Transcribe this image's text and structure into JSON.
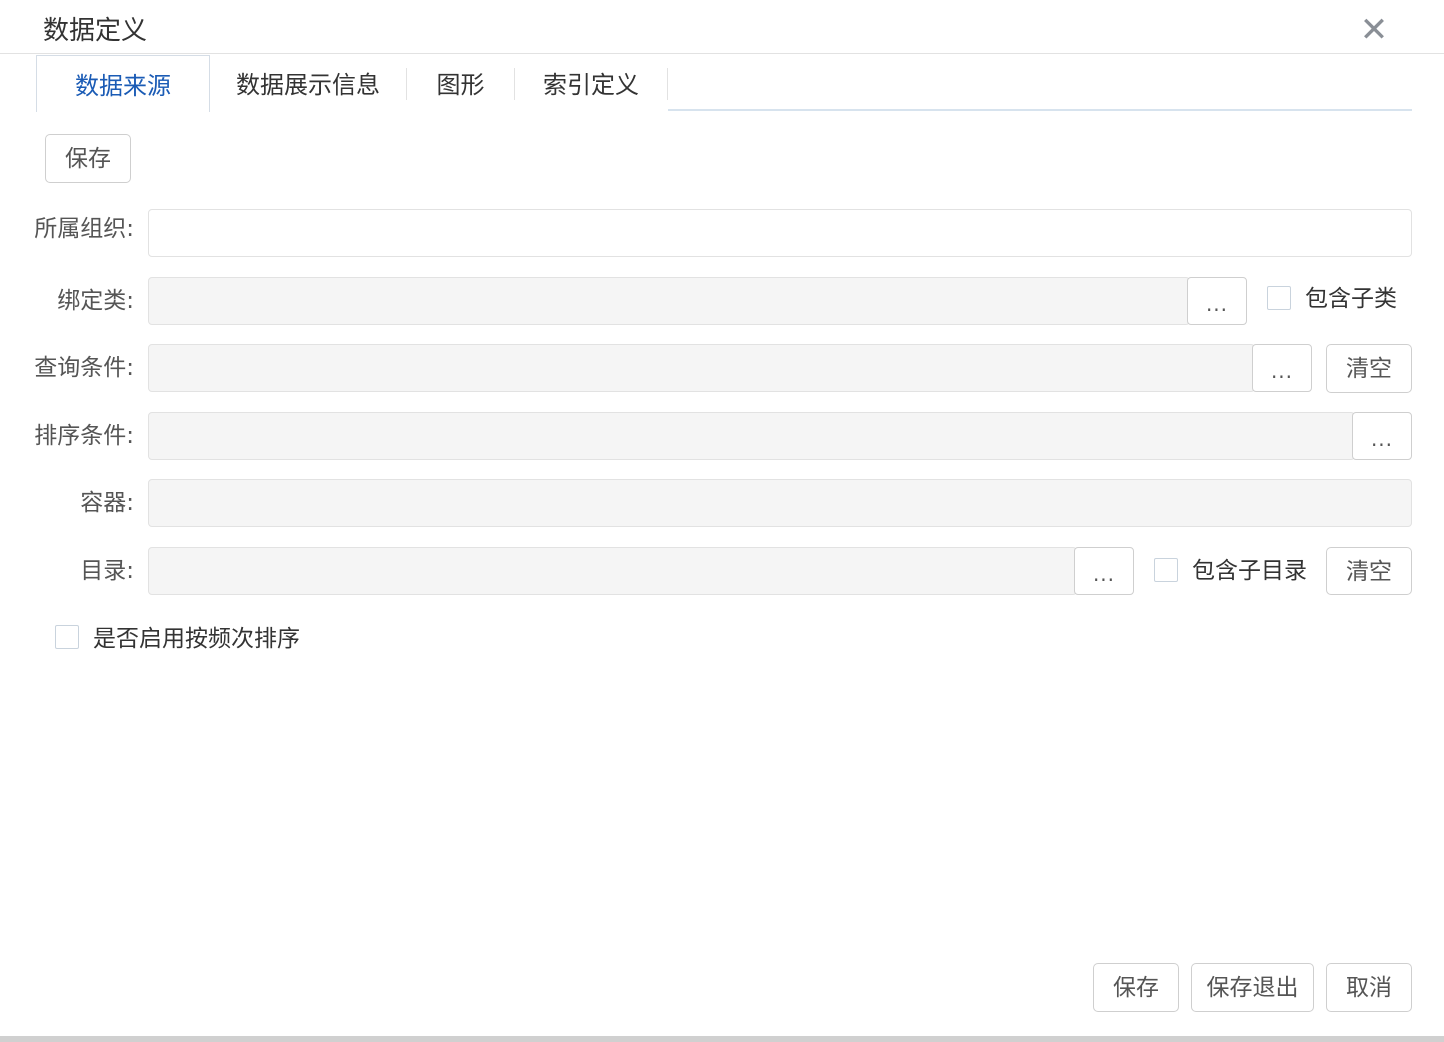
{
  "dialog": {
    "title": "数据定义",
    "close_icon": "close-icon"
  },
  "tabs": [
    {
      "label": "数据来源",
      "active": true
    },
    {
      "label": "数据展示信息",
      "active": false
    },
    {
      "label": "图形",
      "active": false
    },
    {
      "label": "索引定义",
      "active": false
    }
  ],
  "toolbar": {
    "save_label": "保存"
  },
  "form": {
    "org": {
      "label": "所属组织:",
      "value": ""
    },
    "bind_class": {
      "label": "绑定类:",
      "value": "",
      "picker_label": "...",
      "include_sub_label": "包含子类"
    },
    "query": {
      "label": "查询条件:",
      "value": "",
      "picker_label": "...",
      "clear_label": "清空"
    },
    "sort": {
      "label": "排序条件:",
      "value": "",
      "picker_label": "..."
    },
    "container": {
      "label": "容器:",
      "value": ""
    },
    "directory": {
      "label": "目录:",
      "value": "",
      "picker_label": "...",
      "include_sub_label": "包含子目录",
      "clear_label": "清空"
    },
    "frequency_sort": {
      "label": "是否启用按频次排序"
    }
  },
  "footer": {
    "save_label": "保存",
    "save_exit_label": "保存退出",
    "cancel_label": "取消"
  },
  "colors": {
    "accent": "#1a5bb5",
    "field_bg": "#f5f5f5",
    "border": "#cfcfcf"
  }
}
